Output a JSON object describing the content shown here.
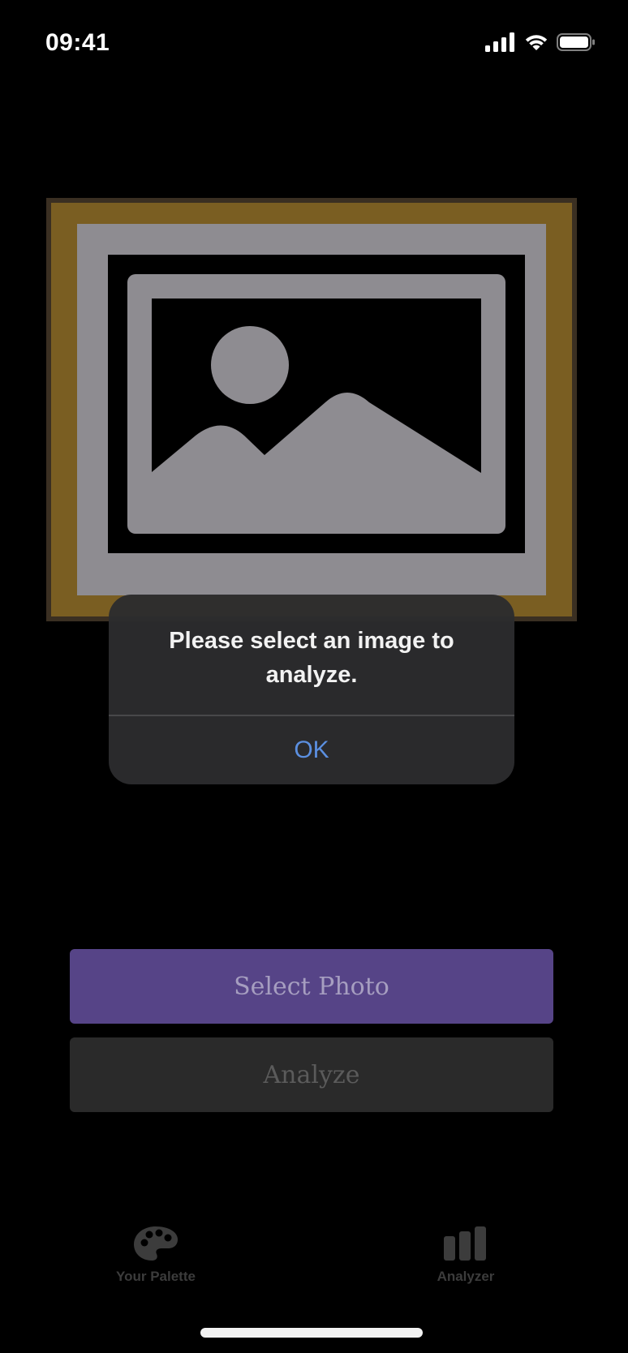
{
  "status_bar": {
    "time": "09:41",
    "icons": [
      "cellular-signal-icon",
      "wifi-icon",
      "battery-icon"
    ]
  },
  "frame": {
    "colors": {
      "outer": "#7a5e22",
      "border": "#3a2f22",
      "mat": "#8e8c91",
      "photo_bg": "#000000",
      "placeholder": "#8e8c91"
    },
    "icon": "photo-placeholder-icon"
  },
  "alert": {
    "message": "Please select an image to analyze.",
    "ok_label": "OK",
    "colors": {
      "background": "#2c2c2e",
      "ok": "#5b8fe0"
    }
  },
  "buttons": {
    "select_photo": "Select Photo",
    "analyze": "Analyze",
    "colors": {
      "select_photo_bg": "#564487",
      "analyze_bg": "#2a2a2a"
    }
  },
  "tab_bar": {
    "items": [
      {
        "label": "Your Palette",
        "icon": "palette-icon"
      },
      {
        "label": "Analyzer",
        "icon": "bar-chart-icon"
      }
    ]
  }
}
